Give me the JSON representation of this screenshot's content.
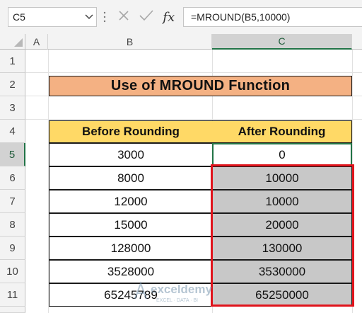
{
  "formula_bar": {
    "name_box": "C5",
    "cancel_icon": "✕",
    "enter_icon": "✓",
    "fx_label": "fx",
    "formula": "=MROUND(B5,10000)"
  },
  "columns": [
    "A",
    "B",
    "C"
  ],
  "rows": [
    "1",
    "2",
    "3",
    "4",
    "5",
    "6",
    "7",
    "8",
    "9",
    "10",
    "11"
  ],
  "sheet": {
    "title": "Use of MROUND Function",
    "headers": [
      "Before Rounding",
      "After Rounding"
    ],
    "data": [
      [
        "3000",
        "0"
      ],
      [
        "8000",
        "10000"
      ],
      [
        "12000",
        "10000"
      ],
      [
        "15000",
        "20000"
      ],
      [
        "128000",
        "130000"
      ],
      [
        "3528000",
        "3530000"
      ],
      [
        "65245789",
        "65250000"
      ]
    ]
  },
  "active_cell": "C5",
  "watermark": {
    "brand": "exceldemy",
    "tagline": "EXCEL · DATA · BI"
  },
  "colors": {
    "title_fill": "#f4b183",
    "header_fill": "#ffd966",
    "result_fill": "#c8c8c8",
    "highlight_border": "#e0141c",
    "selection": "#217346"
  }
}
